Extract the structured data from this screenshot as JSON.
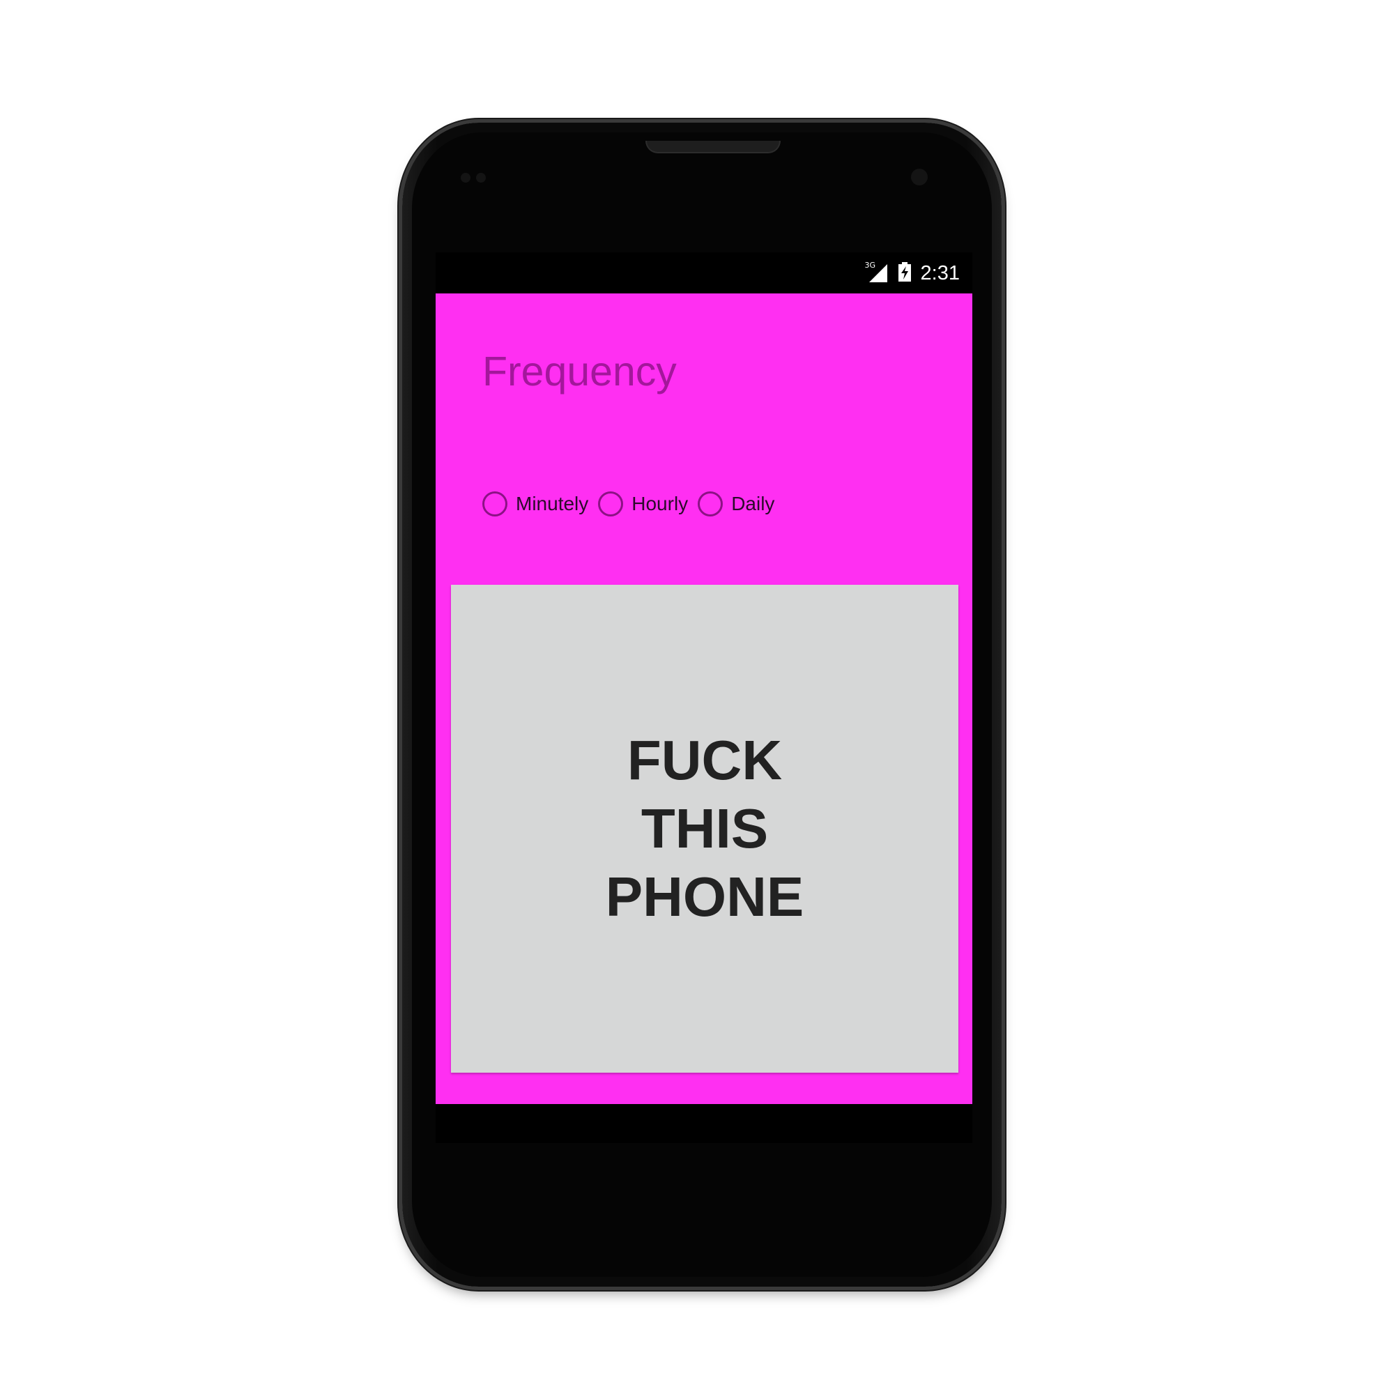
{
  "device": {
    "frame": "android-phone"
  },
  "status_bar": {
    "network": "3G",
    "signal_icon": "signal-icon",
    "battery_icon": "battery-charging-icon",
    "time": "2:31"
  },
  "app": {
    "background_color": "#ff2ff2",
    "title": "Frequency",
    "title_color": "#a3179b",
    "frequency_options": [
      {
        "label": "Minutely",
        "selected": false
      },
      {
        "label": "Hourly",
        "selected": false
      },
      {
        "label": "Daily",
        "selected": false
      }
    ],
    "card": {
      "text": "FUCK THIS PHONE",
      "background_color": "#d6d7d7"
    }
  }
}
